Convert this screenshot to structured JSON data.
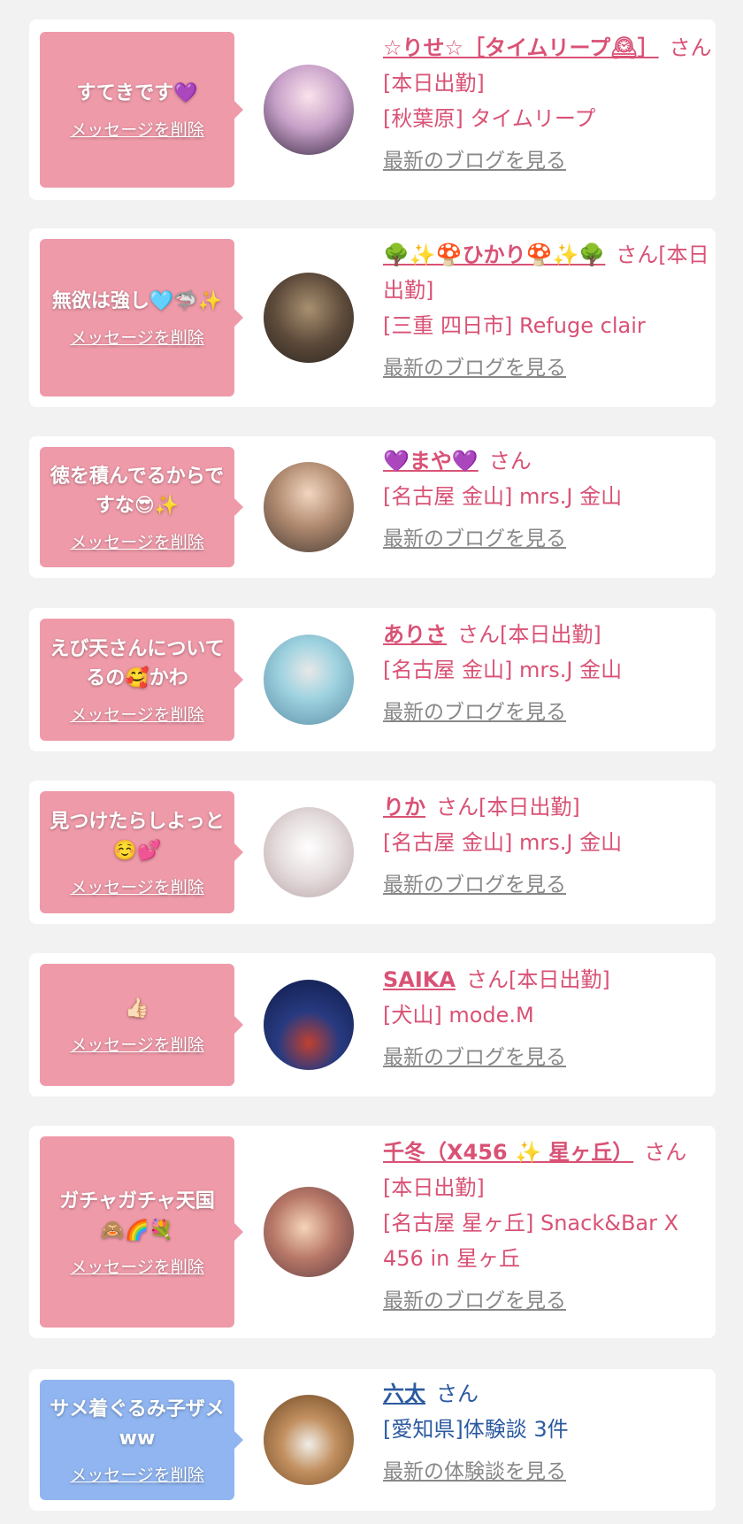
{
  "colors": {
    "bubble_pink": "#ef9aa9",
    "bubble_blue": "#90b5f0",
    "name_pink": "#d95275",
    "name_blue": "#2c5aa0",
    "link_gray": "#888888",
    "background": "#f2f2f2"
  },
  "cards": [
    {
      "message": "すてきです💜",
      "delete_label": "メッセージを削除",
      "name": "☆りせ☆［タイムリープ🕰］",
      "honorific": "さん[本日出勤]",
      "shop": "[秋葉原] タイムリープ",
      "link": "最新のブログを見る"
    },
    {
      "message": "無欲は強し🩵🦈✨",
      "delete_label": "メッセージを削除",
      "name": "🌳✨🍄ひかり🍄✨🌳",
      "honorific": "さん[本日出勤]",
      "shop": "[三重 四日市] Refuge clair",
      "link": "最新のブログを見る"
    },
    {
      "message": "徳を積んでるからですな😎✨",
      "delete_label": "メッセージを削除",
      "name": "💜まや💜",
      "honorific": "さん",
      "shop": "[名古屋 金山] mrs.J 金山",
      "link": "最新のブログを見る"
    },
    {
      "message": "えび天さんについてるの🥰かわ",
      "delete_label": "メッセージを削除",
      "name": "ありさ",
      "honorific": "さん[本日出勤]",
      "shop": "[名古屋 金山] mrs.J 金山",
      "link": "最新のブログを見る"
    },
    {
      "message": "見つけたらしよっと☺️💕",
      "delete_label": "メッセージを削除",
      "name": "りか",
      "honorific": "さん[本日出勤]",
      "shop": "[名古屋 金山] mrs.J 金山",
      "link": "最新のブログを見る"
    },
    {
      "message": "👍🏻",
      "delete_label": "メッセージを削除",
      "name": "SAIKA",
      "honorific": "さん[本日出勤]",
      "shop": "[犬山] mode.M",
      "link": "最新のブログを見る"
    },
    {
      "message": "ガチャガチャ天国🙈🌈💐",
      "delete_label": "メッセージを削除",
      "name": "千冬（X456 ✨ 星ヶ丘）",
      "honorific": "さん[本日出勤]",
      "shop": "[名古屋 星ヶ丘] Snack&Bar X 456 in 星ヶ丘",
      "link": "最新のブログを見る"
    },
    {
      "message": "サメ着ぐるみ子ザメww",
      "delete_label": "メッセージを削除",
      "name": "六太",
      "honorific": "さん",
      "shop": "[愛知県]体験談 3件",
      "link": "最新の体験談を見る"
    }
  ]
}
